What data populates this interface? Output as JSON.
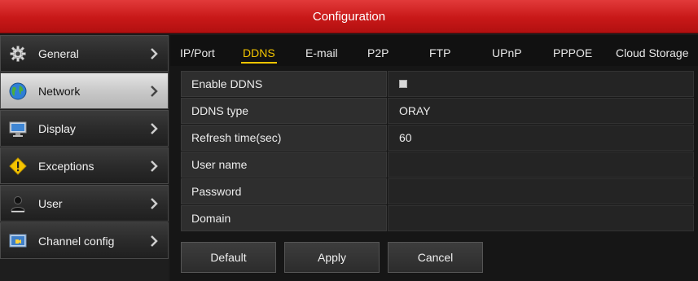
{
  "window": {
    "title": "Configuration"
  },
  "sidebar": {
    "items": [
      {
        "label": "General",
        "icon": "gear-icon",
        "active": false
      },
      {
        "label": "Network",
        "icon": "globe-icon",
        "active": true
      },
      {
        "label": "Display",
        "icon": "monitor-icon",
        "active": false
      },
      {
        "label": "Exceptions",
        "icon": "warning-icon",
        "active": false
      },
      {
        "label": "User",
        "icon": "user-icon",
        "active": false
      },
      {
        "label": "Channel config",
        "icon": "camera-icon",
        "active": false
      }
    ]
  },
  "tabs": [
    {
      "label": "IP/Port",
      "active": false
    },
    {
      "label": "DDNS",
      "active": true
    },
    {
      "label": "E-mail",
      "active": false
    },
    {
      "label": "P2P",
      "active": false
    },
    {
      "label": "FTP",
      "active": false
    },
    {
      "label": "UPnP",
      "active": false
    },
    {
      "label": "PPPOE",
      "active": false
    },
    {
      "label": "Cloud Storage",
      "active": false
    }
  ],
  "form": {
    "enable_ddns": {
      "label": "Enable DDNS",
      "checked": false
    },
    "ddns_type": {
      "label": "DDNS type",
      "value": "ORAY"
    },
    "refresh_time": {
      "label": "Refresh time(sec)",
      "value": "60"
    },
    "user_name": {
      "label": "User name",
      "value": ""
    },
    "password": {
      "label": "Password",
      "value": ""
    },
    "domain": {
      "label": "Domain",
      "value": ""
    }
  },
  "buttons": {
    "default": "Default",
    "apply": "Apply",
    "cancel": "Cancel"
  },
  "colors": {
    "titlebar": "#c81818",
    "active_tab": "#f2c400"
  }
}
